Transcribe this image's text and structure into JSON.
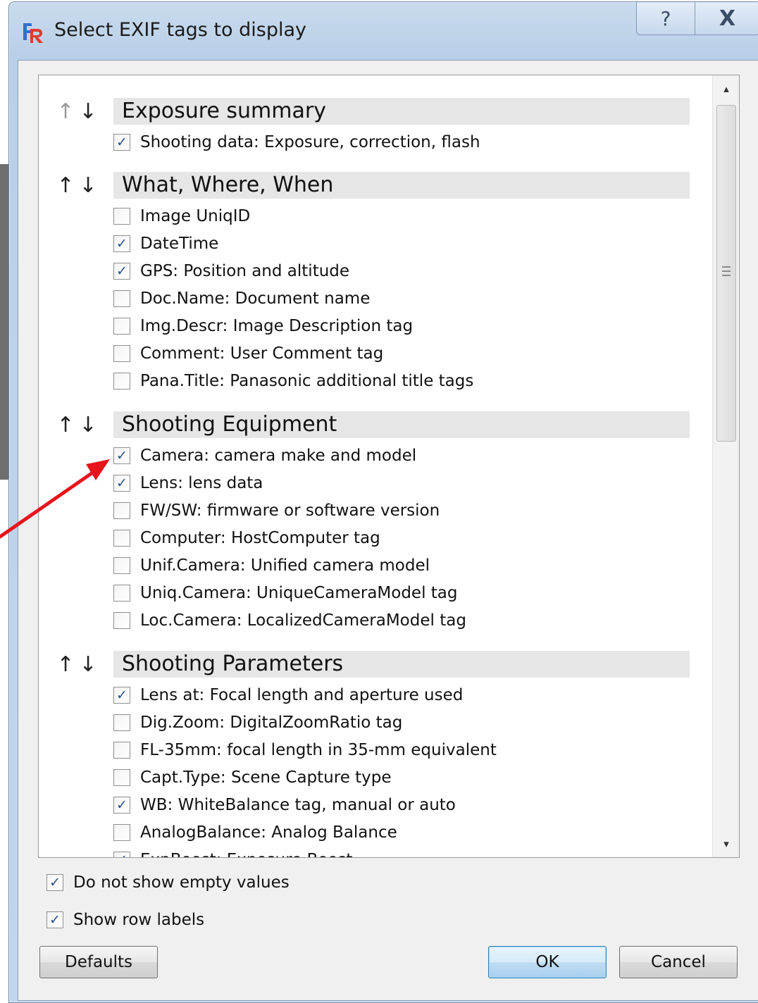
{
  "window": {
    "title": "Select EXIF tags to display",
    "help_glyph": "?",
    "close_glyph": "X"
  },
  "icons": {
    "app": "app-logo-icon",
    "move_up": "↑",
    "move_down": "↓",
    "check": "✓",
    "scroll_up": "▴",
    "scroll_down": "▾"
  },
  "groups": [
    {
      "title": "Exposure summary",
      "items": [
        {
          "label": "Shooting data: Exposure, correction, flash",
          "checked": true
        }
      ]
    },
    {
      "title": "What, Where, When",
      "items": [
        {
          "label": "Image UniqID",
          "checked": false
        },
        {
          "label": "DateTime",
          "checked": true
        },
        {
          "label": "GPS: Position and altitude",
          "checked": true
        },
        {
          "label": "Doc.Name: Document name",
          "checked": false
        },
        {
          "label": "Img.Descr: Image Description tag",
          "checked": false
        },
        {
          "label": "Comment: User Comment tag",
          "checked": false
        },
        {
          "label": "Pana.Title: Panasonic additional title tags",
          "checked": false
        }
      ]
    },
    {
      "title": "Shooting Equipment",
      "items": [
        {
          "label": "Camera: camera make and model",
          "checked": true
        },
        {
          "label": "Lens: lens data",
          "checked": true
        },
        {
          "label": "FW/SW: firmware or software version",
          "checked": false
        },
        {
          "label": "Computer: HostComputer tag",
          "checked": false
        },
        {
          "label": "Unif.Camera: Unified camera model",
          "checked": false
        },
        {
          "label": "Uniq.Camera: UniqueCameraModel tag",
          "checked": false
        },
        {
          "label": "Loc.Camera: LocalizedCameraModel tag",
          "checked": false
        }
      ]
    },
    {
      "title": "Shooting Parameters",
      "items": [
        {
          "label": "Lens at: Focal length and aperture used",
          "checked": true
        },
        {
          "label": "Dig.Zoom: DigitalZoomRatio tag",
          "checked": false
        },
        {
          "label": "FL-35mm: focal length in 35-mm equivalent",
          "checked": false
        },
        {
          "label": "Capt.Type: Scene Capture type",
          "checked": false
        },
        {
          "label": "WB: WhiteBalance tag, manual or auto",
          "checked": true
        },
        {
          "label": "AnalogBalance: Analog Balance",
          "checked": false
        },
        {
          "label": "ExpBoost: Exposure Boost",
          "checked": true
        }
      ]
    }
  ],
  "options": {
    "hide_empty": {
      "label": "Do not show empty values",
      "checked": true
    },
    "row_labels": {
      "label": "Show row labels",
      "checked": true
    }
  },
  "buttons": {
    "defaults": "Defaults",
    "ok": "OK",
    "cancel": "Cancel"
  },
  "colors": {
    "annotation_arrow": "#e8141c",
    "check_mark": "#2a4e8a",
    "title_bar": "#c1d5ec"
  }
}
